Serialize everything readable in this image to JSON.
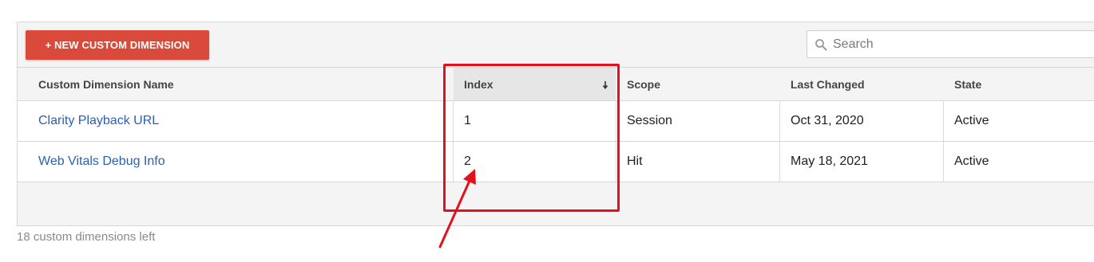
{
  "toolbar": {
    "new_button_label": "+ NEW CUSTOM DIMENSION",
    "search_placeholder": "Search"
  },
  "table": {
    "columns": [
      "Custom Dimension Name",
      "Index",
      "Scope",
      "Last Changed",
      "State"
    ],
    "sorted_column": "Index",
    "rows": [
      {
        "name": "Clarity Playback URL",
        "index": "1",
        "scope": "Session",
        "last_changed": "Oct 31, 2020",
        "state": "Active"
      },
      {
        "name": "Web Vitals Debug Info",
        "index": "2",
        "scope": "Hit",
        "last_changed": "May 18, 2021",
        "state": "Active"
      }
    ]
  },
  "footer": {
    "remaining_text": "18 custom dimensions left"
  },
  "icons": {
    "search": "search-icon",
    "sort": "sort-arrow-down-icon"
  },
  "colors": {
    "accent": "#d94a3a",
    "link": "#2b5fb3",
    "annotation": "#e3111b"
  }
}
